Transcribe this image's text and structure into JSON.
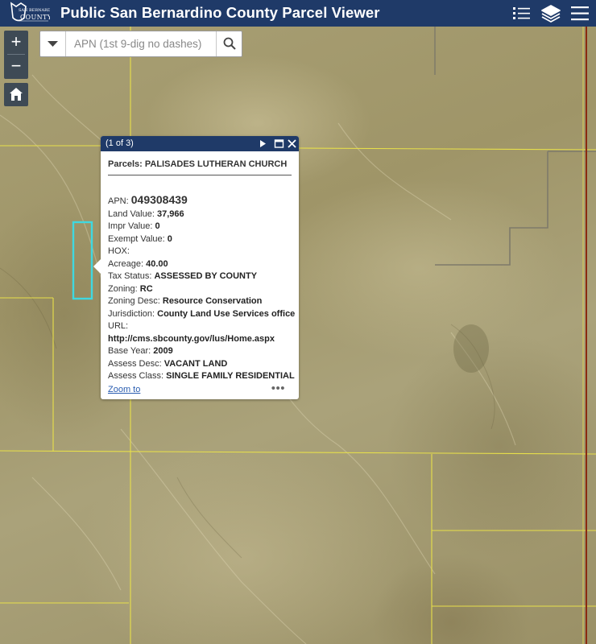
{
  "header": {
    "logo_text": "SAN BERNARDINO COUNTY",
    "title": "Public San Bernardino County Parcel Viewer",
    "icons": [
      "legend-list-icon",
      "layers-icon",
      "menu-icon"
    ],
    "color": "#1f3a68"
  },
  "map_controls": {
    "zoom_in": "+",
    "zoom_out": "−",
    "home_icon": "home-icon"
  },
  "search": {
    "placeholder": "APN (1st 9-dig no dashes)",
    "value": ""
  },
  "popup": {
    "count": "(1 of 3)",
    "title": "Parcels: PALISADES LUTHERAN CHURCH",
    "zoom_to": "Zoom to",
    "more": "•••",
    "attributes": {
      "apn_label": "APN:",
      "apn_value": "049308439",
      "land_value_label": "Land Value:",
      "land_value": "37,966",
      "impr_value_label": "Impr Value:",
      "impr_value": "0",
      "exempt_value_label": "Exempt Value:",
      "exempt_value": "0",
      "hox_label": "HOX:",
      "acreage_label": "Acreage:",
      "acreage": "40.00",
      "tax_status_label": "Tax Status:",
      "tax_status": "ASSESSED BY COUNTY",
      "zoning_label": "Zoning:",
      "zoning": "RC",
      "zoning_desc_label": "Zoning Desc:",
      "zoning_desc": "Resource Conservation",
      "jurisdiction_label": "Jurisdiction:",
      "jurisdiction": "County Land Use Services office",
      "url_label": "URL:",
      "url": "http://cms.sbcounty.gov/lus/Home.aspx",
      "base_year_label": "Base Year:",
      "base_year": "2009",
      "assess_desc_label": "Assess Desc:",
      "assess_desc": "VACANT LAND",
      "assess_class_label": "Assess Class:",
      "assess_class": "SINGLE FAMILY RESIDENTIAL"
    }
  },
  "colors": {
    "parcel_line": "#e8e04a",
    "selected_parcel": "#3fd8e0",
    "road_line": "#8a2a10"
  }
}
